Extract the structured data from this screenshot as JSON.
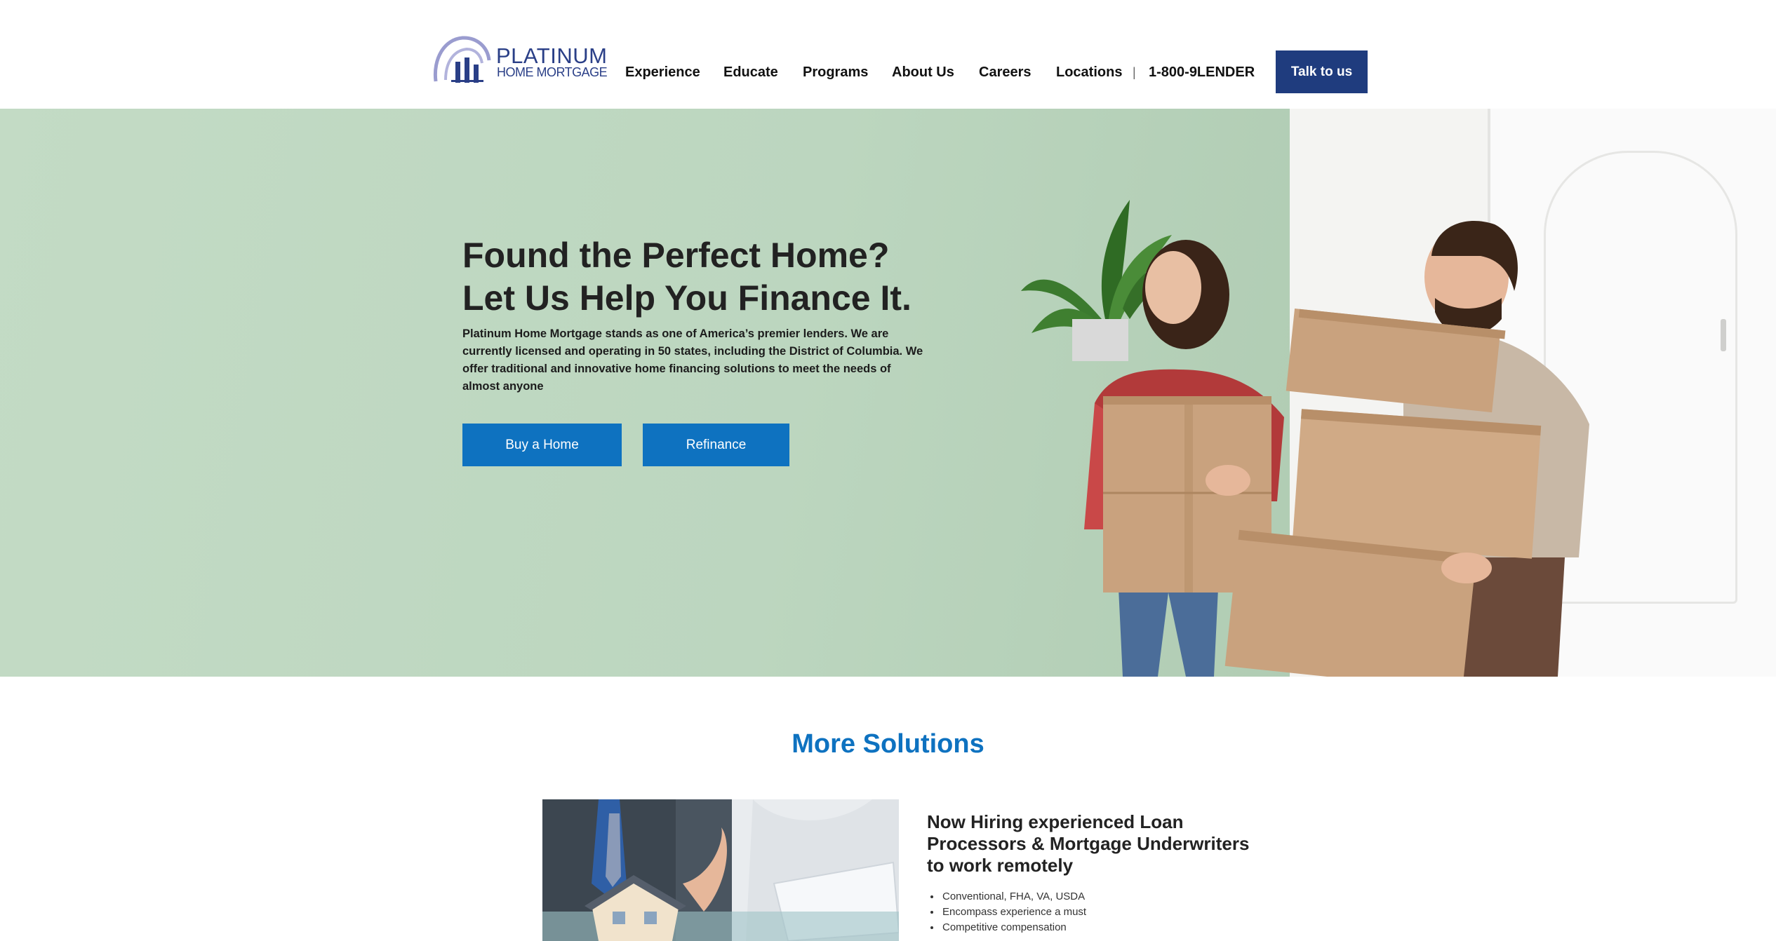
{
  "header": {
    "logo": {
      "word": "PLATINUM",
      "sub": "HOME MORTGAGE"
    },
    "nav": [
      {
        "label": "Experience"
      },
      {
        "label": "Educate"
      },
      {
        "label": "Programs"
      },
      {
        "label": "About Us"
      },
      {
        "label": "Careers"
      },
      {
        "label": "Locations"
      }
    ],
    "separator": "|",
    "phone": "1-800-9LENDER",
    "cta_label": "Talk to us"
  },
  "hero": {
    "title_line1": "Found the Perfect Home?",
    "title_line2": "Let Us Help You Finance It.",
    "text": "Platinum Home Mortgage stands as one of America’s premier lenders. We are currently licensed and operating in 50 states, including the District of Columbia. We offer traditional and innovative home financing solutions to meet the needs of almost anyone",
    "buy_label": "Buy a Home",
    "refinance_label": "Refinance"
  },
  "solutions": {
    "title": "More Solutions",
    "card": {
      "title": "Now Hiring experienced Loan Processors & Mortgage Underwriters to work remotely",
      "bullets": [
        "Conventional, FHA, VA, USDA",
        "Encompass experience a must",
        "Competitive compensation"
      ]
    }
  },
  "colors": {
    "brand_navy": "#1f3c7e",
    "accent_blue": "#0e72c0",
    "hero_green": "#bcd6bf"
  }
}
